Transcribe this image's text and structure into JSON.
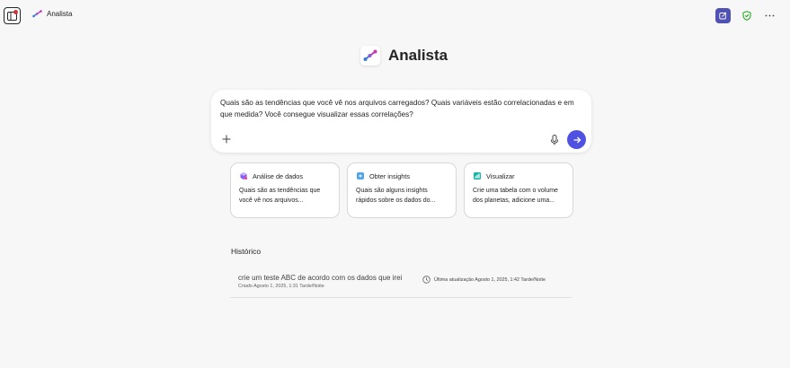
{
  "header": {
    "app_name": "Analista",
    "icons": [
      "sidebar-toggle-icon",
      "analista-logo-icon",
      "new-chat-icon",
      "shield-check-icon",
      "more-icon"
    ]
  },
  "main": {
    "title": "Analista",
    "composer": {
      "text": "Quais são as tendências que você vê nos arquivos carregados? Quais variáveis estão correlacionadas e em que medida? Você consegue visualizar essas correlações?"
    },
    "suggestions": [
      {
        "title": "Análise de dados",
        "body": "Quais são as tendências que você vê nos arquivos...",
        "icon": "data-analysis-icon"
      },
      {
        "title": "Obter insights",
        "body": "Quais são alguns insights rápidos sobre os dados do...",
        "icon": "insights-icon"
      },
      {
        "title": "Visualizar",
        "body": "Crie uma tabela com o volume dos planetas, adicione uma...",
        "icon": "visualize-icon"
      }
    ],
    "history": {
      "title": "Histórico",
      "items": [
        {
          "name": "crie um teste ABC de acordo com os dados que irei",
          "created": "Criado Agosto 1, 2025, 1:31 Tarde/Noite",
          "updated": "Última atualização Agosto 1, 2025, 1:42 Tarde/Noite"
        }
      ]
    }
  },
  "colors": {
    "accent": "#4f52e0",
    "background": "#f7f7f8",
    "shield": "#13a10e",
    "notification_dot": "#d13438"
  }
}
